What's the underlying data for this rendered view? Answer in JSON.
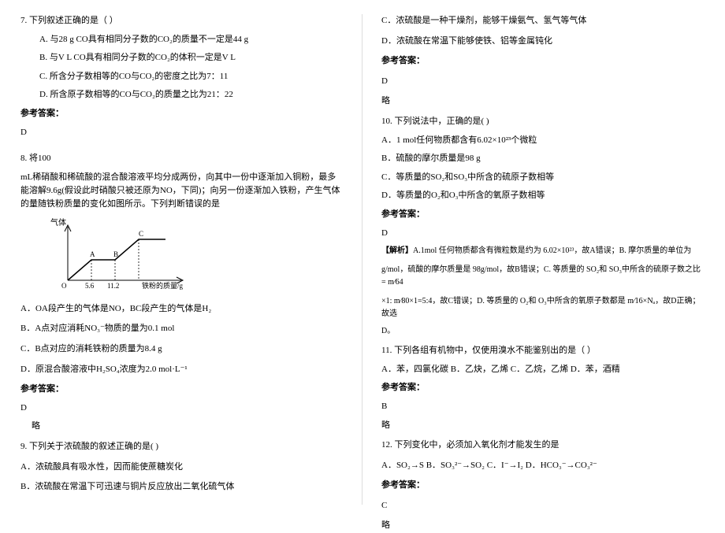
{
  "left": {
    "q7": {
      "stem": "7. 下列叙述正确的是（   ）",
      "A": "A. 与28 g CO具有相同分子数的CO₂的质量不一定是44 g",
      "B": "B. 与V L CO具有相同分子数的CO₂的体积一定是V L",
      "C": "C. 所含分子数相等的CO与CO₂的密度之比为7：11",
      "D": "D. 所含原子数相等的CO与CO₂的质量之比为21：22",
      "ansLabel": "参考答案：",
      "ans": "D"
    },
    "q8": {
      "stem1": "8.  将100",
      "stem2": "mL稀硝酸和稀硫酸的混合酸溶液平均分成两份，向其中一份中逐渐加入铜粉，最多能溶解9.6g(假设此时硝酸只被还原为NO，下同)；向另一份逐渐加入铁粉，产生气体的量随铁粉质量的变化如图所示。下列判断错误的是",
      "yLabel": "气体",
      "xLabel": "铁粉的质量/g",
      "A": "A．OA段产生的气体是NO，BC段产生的气体是H₂",
      "B": "B．A点对应消耗NO₃⁻物质的量为0.1 mol",
      "C": "C．B点对应的消耗铁粉的质量为8.4 g",
      "D": "D．原混合酸溶液中H₂SO₄浓度为2.0 mol·L⁻¹",
      "ansLabel": "参考答案：",
      "ans": "D",
      "exp": "略"
    },
    "q9": {
      "stem": "9. 下列关于浓硫酸的叙述正确的是(       )",
      "A": "A．浓硫酸具有吸水性，因而能使蔗糖炭化",
      "B": "B．浓硫酸在常温下可迅速与铜片反应放出二氧化硫气体"
    }
  },
  "right": {
    "q9c": {
      "C": "C．浓硫酸是一种干燥剂，能够干燥氨气、氢气等气体",
      "D": "D．浓硫酸在常温下能够使铁、铝等金属钝化",
      "ansLabel": "参考答案：",
      "ans": "D",
      "exp": "略"
    },
    "q10": {
      "stem": "10. 下列说法中，正确的是(       )",
      "A": "A．1 mol任何物质都含有6.02×10²³个微粒",
      "B": "B．硫酸的摩尔质量是98 g",
      "C": "C．等质量的SO₂和SO₃中所含的硫原子数相等",
      "D": "D．等质量的O₂和O₃中所含的氧原子数相等",
      "ansLabel": "参考答案：",
      "ans": "D",
      "expTitle": "【解析】",
      "exp1": "A.1mol 任何物质都含有微粒数是约为 6.02×10²³，故A错误；B. 摩尔质量的单位为",
      "exp2": "g/mol，硫酸的摩尔质量是 98g/mol，故B错误；C. 等质量的 SO₂和 SO₃中所含的硫原子数之比= m⁄64",
      "exp3": "×1: m⁄80×1=5:4，故C错误；D. 等质量的 O₂和 O₃中所含的氧原子数都是 m⁄16×Nₐ，故D正确；故选",
      "exp4": "D。"
    },
    "q11": {
      "stem": "11. 下列各组有机物中，仅使用溴水不能鉴别出的是（   ）",
      "opts": "A．苯，四氯化碳      B．乙炔，乙烯       C．乙烷，乙烯       D．苯，酒精",
      "ansLabel": "参考答案：",
      "ans": "B",
      "exp": "略"
    },
    "q12": {
      "stem": "12. 下列变化中，必须加入氧化剂才能发生的是",
      "opts": "A．SO₂→S    B．SO₃²⁻→SO₂    C．I⁻→I₂   D．HCO₃⁻→CO₃²⁻",
      "ansLabel": "参考答案：",
      "ans": "C",
      "exp": "略"
    }
  },
  "chart_data": {
    "type": "line",
    "title": "",
    "xlabel": "铁粉的质量/g",
    "ylabel": "气体",
    "x": [
      0,
      5.6,
      11.2,
      16.8,
      22.4
    ],
    "points_labeled": {
      "A": 5.6,
      "B": 11.2,
      "C": 16.8
    },
    "series": [
      {
        "name": "gas-volume",
        "values": [
          0,
          1,
          1,
          2,
          2
        ]
      }
    ],
    "xlim": [
      0,
      24
    ],
    "ylim": [
      0,
      2.2
    ],
    "notes": "Line rises O→A, flat A→B, rises B→C, flat after C. y-values are relative heights (unlabelled axis)."
  }
}
